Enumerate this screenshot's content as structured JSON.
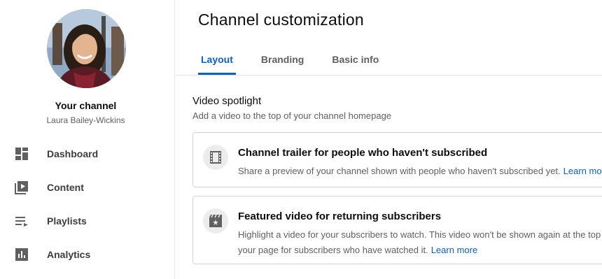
{
  "sidebar": {
    "channel_title": "Your channel",
    "channel_name": "Laura Bailey-Wickins",
    "items": [
      {
        "label": "Dashboard",
        "icon": "dashboard-icon"
      },
      {
        "label": "Content",
        "icon": "content-icon"
      },
      {
        "label": "Playlists",
        "icon": "playlists-icon"
      },
      {
        "label": "Analytics",
        "icon": "analytics-icon"
      }
    ]
  },
  "main": {
    "title": "Channel customization",
    "tabs": [
      {
        "label": "Layout",
        "active": true
      },
      {
        "label": "Branding",
        "active": false
      },
      {
        "label": "Basic info",
        "active": false
      }
    ],
    "section": {
      "title": "Video spotlight",
      "subtitle": "Add a video to the top of your channel homepage"
    },
    "cards": [
      {
        "icon": "film-icon",
        "title": "Channel trailer for people who haven't subscribed",
        "description": "Share a preview of your channel shown with people who haven't subscribed yet.",
        "link": "Learn more"
      },
      {
        "icon": "featured-video-icon",
        "title": "Featured video for returning subscribers",
        "description": "Highlight a video for your subscribers to watch. This video won't be shown again at the top of your page for subscribers who have watched it.",
        "link": "Learn more"
      }
    ]
  },
  "colors": {
    "accent": "#065fd4",
    "text_primary": "#0d0d0d",
    "text_secondary": "#606060",
    "border": "#d3d3d3"
  }
}
